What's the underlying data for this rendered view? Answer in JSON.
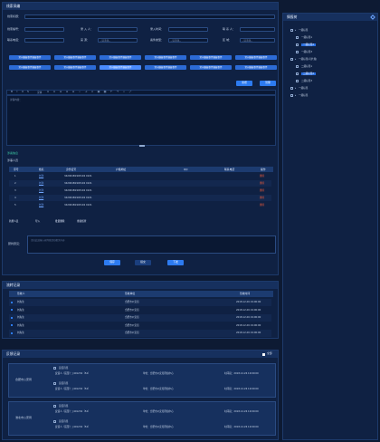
{
  "form_panel": {
    "title": "线索采编",
    "fields": {
      "clue_title": {
        "label": "线索标题：",
        "value": ""
      },
      "clue_number": {
        "label": "线索编号：",
        "value": ""
      },
      "reporter": {
        "label": "录 入 人：",
        "value": ""
      },
      "entry_time": {
        "label": "录入时间：",
        "value": ""
      },
      "contact": {
        "label": "联 系 人：",
        "value": ""
      },
      "phone": {
        "label": "联系电话：",
        "value": ""
      },
      "source": {
        "label": "来 源：",
        "placeholder": "--请选择--"
      },
      "case_type": {
        "label": "案件类型：",
        "placeholder": "--请选择--"
      },
      "area": {
        "label": "区 域：",
        "placeholder": "--请选择--"
      },
      "tags_label": "标 签："
    },
    "tags": [
      "常州嫌疑事件嫌疑事件",
      "常州嫌疑事件嫌疑事件",
      "常州嫌疑事件嫌疑事件",
      "常州嫌疑事件嫌疑事件",
      "常州嫌疑事件嫌疑事件",
      "常州嫌疑事件嫌疑事件",
      "常州嫌疑事件嫌疑事件",
      "常州嫌疑事件嫌疑事件",
      "常州嫌疑事件嫌疑事件",
      "常州嫌疑事件嫌疑事件",
      "常州嫌疑事件嫌疑事件",
      "常州嫌疑事件嫌疑事件"
    ],
    "tag_selected_index": 8,
    "actions": {
      "add_label": "新增",
      "manage_label": "管理"
    },
    "editor": {
      "placeholder": "详情内容：",
      "font_value": "宋体"
    },
    "suspects": {
      "title": "涉案信息",
      "subtitle": "涉事人员",
      "headers": [
        "序号",
        "姓名",
        "身份证号",
        "户籍地址",
        "QQ",
        "联系电话",
        "操作"
      ],
      "rows": [
        {
          "no": "1",
          "name": "刘洋",
          "id": "342901B1993102 0221",
          "addr": "",
          "qq": "",
          "tel": "",
          "op": "删除"
        },
        {
          "no": "2",
          "name": "刘洋",
          "id": "342901B1993102 0221",
          "addr": "",
          "qq": "",
          "tel": "",
          "op": "删除"
        },
        {
          "no": "3",
          "name": "刘洋",
          "id": "342901B1993102 0221",
          "addr": "",
          "qq": "",
          "tel": "",
          "op": "删除"
        },
        {
          "no": "4",
          "name": "刘洋",
          "id": "342901B1993102 0221",
          "addr": "",
          "qq": "",
          "tel": "",
          "op": "删除"
        },
        {
          "no": "5",
          "name": "刘洋",
          "id": "342901B1993102 0221",
          "addr": "",
          "qq": "",
          "tel": "",
          "op": "删除"
        }
      ],
      "links": [
        "新增人员",
        "导入",
        "批量删除",
        "重复核查"
      ]
    },
    "opinion": {
      "label": "研判意见：",
      "placeholder": "请在此处输入研判意见和相关内容"
    },
    "buttons": {
      "save": "保存",
      "submit": "提交",
      "issue": "下发"
    }
  },
  "transfer_panel": {
    "title": "流转记录",
    "headers": [
      "签收人",
      "签收单位",
      "签收时间"
    ],
    "rows": [
      {
        "who": "刘先生",
        "unit": "合肥市公安局",
        "time": "2018.12.26  19:00:00"
      },
      {
        "who": "刘先生",
        "unit": "合肥市公安局",
        "time": "2018.12.26  19:00:00"
      },
      {
        "who": "刘先生",
        "unit": "合肥市公安局",
        "time": "2018.12.26  19:00:00"
      },
      {
        "who": "刘先生",
        "unit": "合肥市公安局",
        "time": "2018.12.26  19:00:00"
      },
      {
        "who": "刘先生",
        "unit": "合肥市公安局",
        "time": "2018.12.26  19:00:00"
      }
    ]
  },
  "feedback_panel": {
    "title": "反馈记录",
    "toggle": "全部",
    "groups": [
      {
        "org": "合肥市公安局",
        "items": [
          {
            "label": "意见待签",
            "person": "反馈人（民警）：J401234（54）",
            "unit": "单位：合肥市公安局刑侦中心",
            "time": "时间段：2018.12.26 19:00:00"
          },
          {
            "label": "意见待签",
            "person": "反馈人（民警）：J401234（54）",
            "unit": "单位：合肥市公安局刑侦中心",
            "time": "时间段：2018.12.26 19:00:00"
          }
        ]
      },
      {
        "org": "淮北市公安局",
        "items": [
          {
            "label": "意见待签",
            "person": "反馈人（民警）：J401234（54）",
            "unit": "单位：合肥市公安局刑侦中心",
            "time": "时间段：2018.12.26 19:00:00"
          },
          {
            "label": "意见待签",
            "person": "反馈人（民警）：J401234（54）",
            "unit": "单位：合肥市公安局刑侦中心",
            "time": "时间段：2018.12.26 19:00:00"
          }
        ]
      }
    ]
  },
  "tree_panel": {
    "title": "情报树",
    "nodes": [
      {
        "level": 0,
        "label": "一级标签"
      },
      {
        "level": 1,
        "label": "一级标签1"
      },
      {
        "level": 1,
        "label": "一级标签2",
        "selected": true
      },
      {
        "level": 1,
        "label": "一级标签3"
      },
      {
        "level": 0,
        "label": "一级标签(可扩展)"
      },
      {
        "level": 1,
        "label": "二级标签1"
      },
      {
        "level": 1,
        "label": "二级标签2",
        "selected": true
      },
      {
        "level": 1,
        "label": "二级标签3"
      },
      {
        "level": 0,
        "label": "一级标签"
      },
      {
        "level": 0,
        "label": "一级标签"
      }
    ]
  }
}
